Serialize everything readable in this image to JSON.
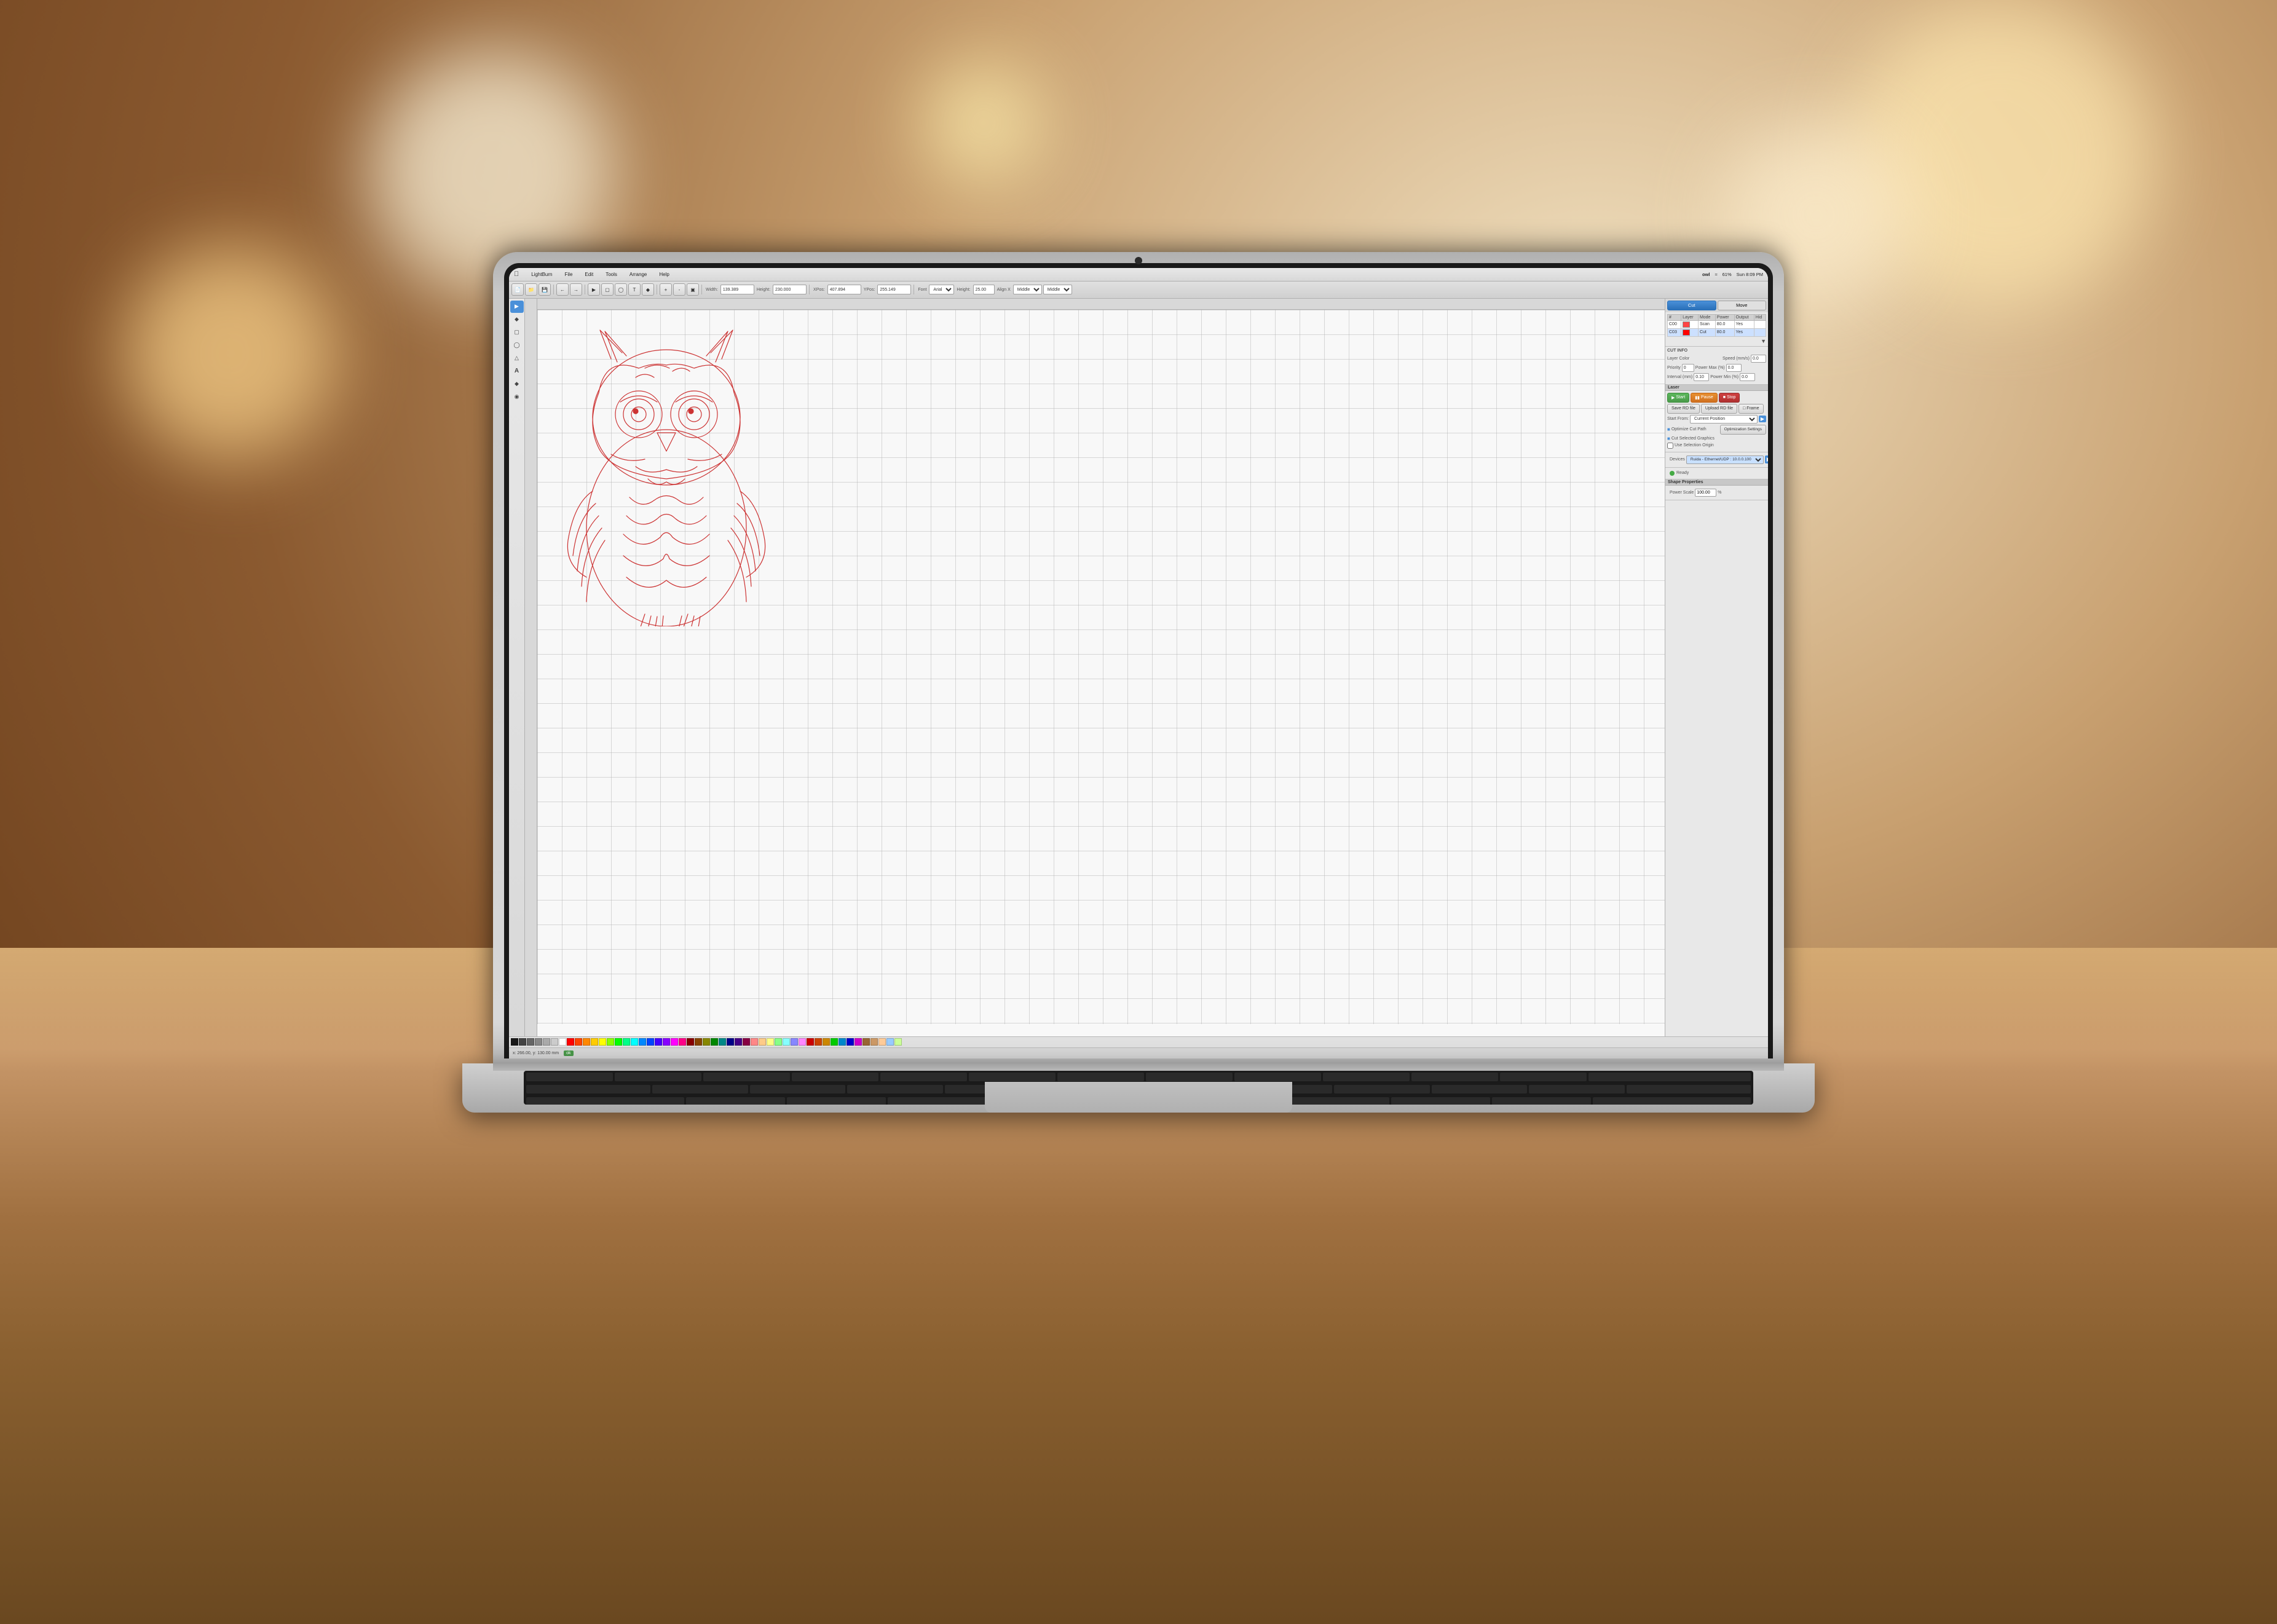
{
  "bg": {
    "title": "LightBurn background scene"
  },
  "menubar": {
    "app_name": "LightBurn",
    "menus": [
      "File",
      "Edit",
      "Tools",
      "Arrange",
      "Help"
    ],
    "right": {
      "wifi": "61%",
      "time": "Sun 8:09 PM"
    },
    "window_title": "owl"
  },
  "toolbar": {
    "buttons": [
      "new",
      "open",
      "save",
      "undo",
      "redo",
      "copy",
      "paste",
      "delete",
      "move",
      "select",
      "zoom",
      "fit",
      "node",
      "text",
      "shape"
    ],
    "width_label": "Width:",
    "width_value": "139.389",
    "height_label": "Height:",
    "height_value": "230.000",
    "xpos_label": "XPos:",
    "xpos_value": "407.894",
    "ypos_label": "YPos:",
    "ypos_value": "255.149",
    "font_label": "Font",
    "font_value": "Arial",
    "height2_label": "Height:",
    "height2_value": "25.00",
    "align_x_label": "Align X",
    "align_x_value": "Middle",
    "align_y_label": "Middle"
  },
  "layers": {
    "columns": [
      "#",
      "Layer",
      "Mode",
      "Power",
      "Output",
      "Hid"
    ],
    "rows": [
      {
        "num": "C00",
        "color": "#ff4444",
        "mode": "Scan",
        "power": "80.0",
        "output": true,
        "hidden": false
      },
      {
        "num": "C03",
        "color": "#ff0000",
        "mode": "Cut",
        "power": "80.0",
        "output": true,
        "hidden": false
      }
    ]
  },
  "cut_info": {
    "layer_color_label": "Layer Color",
    "speed_label": "Speed (mm/s)",
    "speed_value": "0.0",
    "priority_label": "Priority",
    "priority_value": "0",
    "power_max_label": "Power Max (%)",
    "power_max_value": "0.0",
    "interval_label": "Interval (mm)",
    "interval_value": "0.10",
    "power_min_label": "Power Min (%)",
    "power_min_value": "0.0"
  },
  "laser_panel": {
    "section_label": "Laser",
    "start_label": "Start",
    "pause_label": "Pause",
    "stop_label": "Stop",
    "save_rd_label": "Save RD file",
    "upload_rd_label": "Upload RD file",
    "frame_label": "Frame",
    "start_from_label": "Start From:",
    "start_from_value": "Current Position",
    "optimize_label": "Optimize Cut Path",
    "optimization_settings_label": "Optimization Settings",
    "cut_selected_label": "Cut Selected Graphics",
    "use_selection_label": "Use Selection Origin",
    "devices_label": "Devices",
    "device_name": "Ruida - Ethernet/UDP : 10.0.0.100",
    "ready_label": "Ready",
    "shape_properties_label": "Shape Properties",
    "power_scale_label": "Power Scale",
    "power_scale_value": "100.00",
    "power_scale_unit": "%"
  },
  "status": {
    "position": "x: 266.00, y: 130.00 mm",
    "ok_label": "ok"
  },
  "palette_colors": [
    "#1a1a1a",
    "#444444",
    "#666666",
    "#888888",
    "#aaaaaa",
    "#cccccc",
    "#ffffff",
    "#ff0000",
    "#ff4400",
    "#ff8800",
    "#ffcc00",
    "#ffff00",
    "#88ff00",
    "#00ff00",
    "#00ff88",
    "#00ffff",
    "#0088ff",
    "#0044ff",
    "#4400ff",
    "#8800ff",
    "#ff00ff",
    "#ff0088",
    "#880000",
    "#884400",
    "#888800",
    "#008800",
    "#008888",
    "#000088",
    "#440088",
    "#880044",
    "#ff8888",
    "#ffcc88",
    "#ffff88",
    "#88ff88",
    "#88ffff",
    "#8888ff",
    "#ff88ff",
    "#cc0000",
    "#cc4400",
    "#cc8800",
    "#00cc00",
    "#0088cc",
    "#0000cc",
    "#cc00cc",
    "#996633",
    "#cc9966",
    "#ffcc99",
    "#99ccff",
    "#ccff99"
  ]
}
